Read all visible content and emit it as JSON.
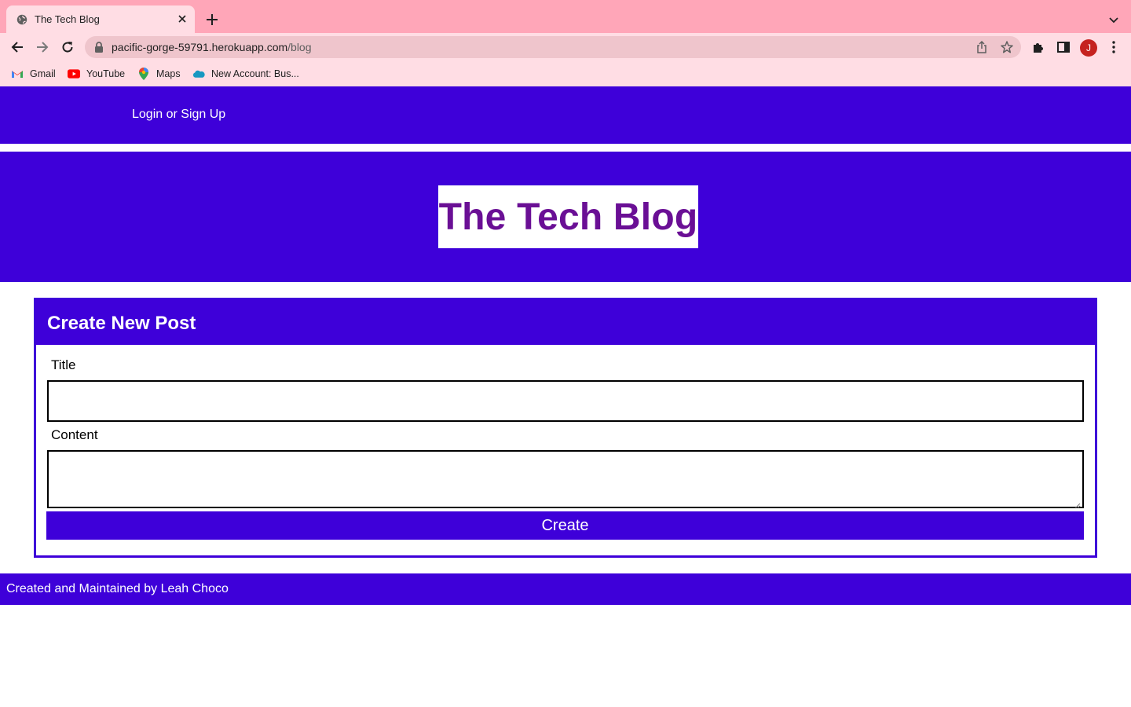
{
  "browser": {
    "tab": {
      "title": "The Tech Blog"
    },
    "address": {
      "host": "pacific-gorge-59791.herokuapp.com",
      "path": "/blog"
    },
    "avatar_initial": "J",
    "bookmarks": [
      {
        "label": "Gmail",
        "icon": "gmail-icon"
      },
      {
        "label": "YouTube",
        "icon": "youtube-icon"
      },
      {
        "label": "Maps",
        "icon": "maps-icon"
      },
      {
        "label": "New Account: Bus...",
        "icon": "salesforce-cloud-icon"
      }
    ],
    "colors": {
      "tabstrip": "#ffa6b8",
      "toolbar": "#ffdde4",
      "omnibox": "#efc5cc"
    }
  },
  "site": {
    "nav": {
      "login_label": "Login or Sign Up"
    },
    "hero": {
      "title": "The Tech Blog"
    },
    "form": {
      "heading": "Create New Post",
      "title_label": "Title",
      "title_value": "",
      "content_label": "Content",
      "content_value": "",
      "submit_label": "Create"
    },
    "footer": {
      "text": "Created and Maintained by Leah Choco"
    },
    "colors": {
      "primary": "#3e00d9",
      "title_text": "#6a0f95"
    }
  }
}
